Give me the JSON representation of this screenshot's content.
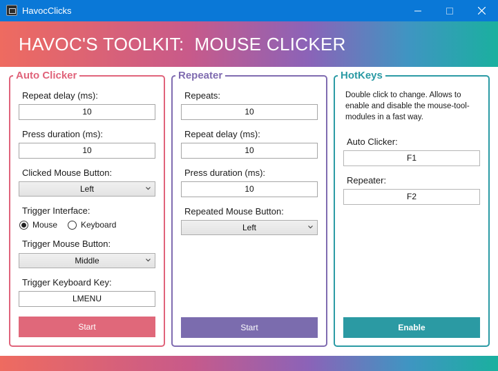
{
  "window": {
    "title": "HavocClicks"
  },
  "header": {
    "title": "HAVOC'S TOOLKIT:  MOUSE CLICKER"
  },
  "auto_clicker": {
    "title": "Auto Clicker",
    "repeat_delay_label": "Repeat delay (ms):",
    "repeat_delay_value": "10",
    "press_duration_label": "Press duration (ms):",
    "press_duration_value": "10",
    "clicked_button_label": "Clicked Mouse Button:",
    "clicked_button_value": "Left",
    "trigger_interface_label": "Trigger Interface:",
    "trigger_interface_options": [
      "Mouse",
      "Keyboard"
    ],
    "trigger_interface_selected": "Mouse",
    "trigger_mouse_label": "Trigger Mouse Button:",
    "trigger_mouse_value": "Middle",
    "trigger_key_label": "Trigger Keyboard Key:",
    "trigger_key_value": "LMENU",
    "start_label": "Start",
    "accent_color": "#e0637a"
  },
  "repeater": {
    "title": "Repeater",
    "repeats_label": "Repeats:",
    "repeats_value": "10",
    "repeat_delay_label": "Repeat delay (ms):",
    "repeat_delay_value": "10",
    "press_duration_label": "Press duration (ms):",
    "press_duration_value": "10",
    "repeated_button_label": "Repeated Mouse Button:",
    "repeated_button_value": "Left",
    "start_label": "Start",
    "accent_color": "#7f6bb0"
  },
  "hotkeys": {
    "title": "HotKeys",
    "description": "Double click to change. Allows to enable and disable the mouse-tool-modules in a fast way.",
    "auto_clicker_label": "Auto Clicker:",
    "auto_clicker_key": "F1",
    "repeater_label": "Repeater:",
    "repeater_key": "F2",
    "enable_label": "Enable",
    "accent_color": "#2a9aa4"
  },
  "icons": {
    "app": "app-icon",
    "minimize": "minimize-icon",
    "maximize": "maximize-icon",
    "close": "close-icon",
    "dropdown": "chevron-down-icon"
  },
  "colors": {
    "titlebar": "#0a78d7",
    "gradient_start": "#ee6b60",
    "gradient_end": "#1ab09f",
    "auto_start_button": "#e0687a",
    "repeater_start_button": "#7b6cae",
    "enable_button": "#2b9aa3"
  }
}
